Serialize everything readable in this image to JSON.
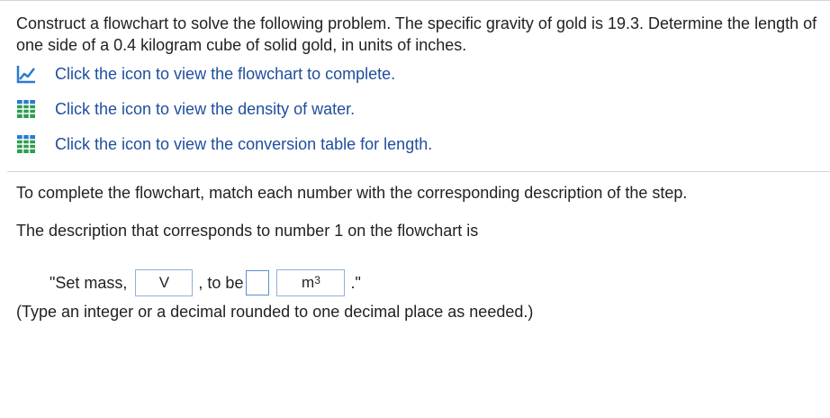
{
  "problem_text": "Construct a flowchart to solve the following problem. The specific gravity of gold is 19.3. Determine the length of one side of a 0.4 kilogram cube of solid gold, in units of inches.",
  "resources": [
    {
      "label": "Click the icon to view the flowchart to complete.",
      "icon": "chart-icon"
    },
    {
      "label": "Click the icon to view the density of water.",
      "icon": "table-icon"
    },
    {
      "label": "Click the icon to view the conversion table for length.",
      "icon": "table-icon"
    }
  ],
  "instructions": {
    "line1": "To complete the flowchart, match each number with the corresponding description of the step.",
    "line2": "The description that corresponds to number 1 on the flowchart is"
  },
  "answer": {
    "prefix": "\"Set mass,",
    "select_value": "V",
    "middle": ", to be",
    "blank_value": "",
    "unit_base": "m",
    "unit_exp": "3",
    "suffix": ".\""
  },
  "hint": "(Type an integer or a decimal rounded to one decimal place as needed.)",
  "colors": {
    "link": "#1f4e9c",
    "icon_blue": "#2a7bd0",
    "icon_green": "#2e9e4f",
    "input_border": "#5b8fcf"
  }
}
